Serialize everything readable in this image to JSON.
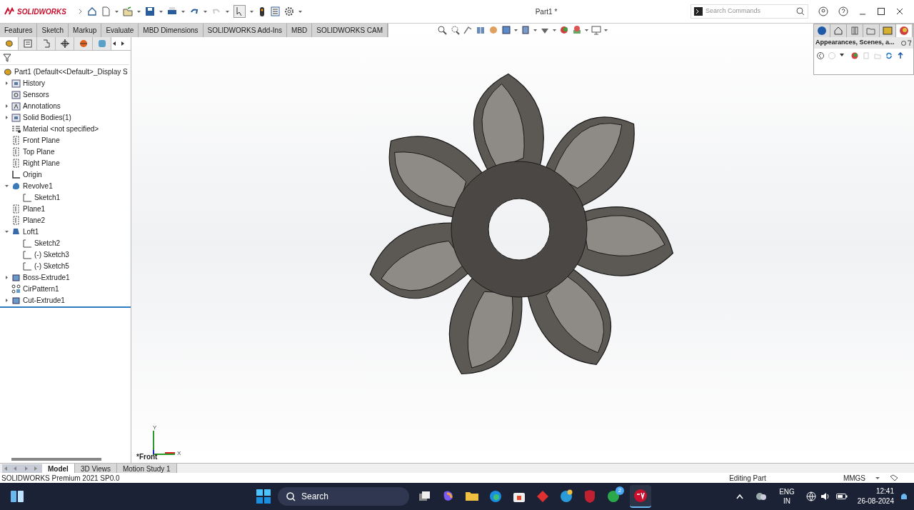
{
  "app": {
    "logo": "SOLIDWORKS",
    "title": "Part1 *",
    "search": {
      "placeholder": "Search Commands"
    }
  },
  "command_tabs": [
    {
      "label": "Features",
      "selected": false
    },
    {
      "label": "Sketch",
      "selected": false
    },
    {
      "label": "Markup",
      "selected": false
    },
    {
      "label": "Evaluate",
      "selected": false
    },
    {
      "label": "MBD Dimensions",
      "selected": false
    },
    {
      "label": "SOLIDWORKS Add-Ins",
      "selected": false
    },
    {
      "label": "MBD",
      "selected": false
    },
    {
      "label": "SOLIDWORKS CAM",
      "selected": false
    }
  ],
  "feature_tree": {
    "root": "Part1  (Default<<Default>_Display S",
    "items": [
      {
        "label": "History",
        "kind": "folder",
        "expanded": false
      },
      {
        "label": "Sensors",
        "kind": "sensor"
      },
      {
        "label": "Annotations",
        "kind": "annotation",
        "expanded": false
      },
      {
        "label": "Solid Bodies(1)",
        "kind": "folder",
        "expanded": false
      },
      {
        "label": "Material <not specified>",
        "kind": "material"
      },
      {
        "label": "Front Plane",
        "kind": "plane"
      },
      {
        "label": "Top Plane",
        "kind": "plane"
      },
      {
        "label": "Right Plane",
        "kind": "plane"
      },
      {
        "label": "Origin",
        "kind": "origin"
      },
      {
        "label": "Revolve1",
        "kind": "revolve",
        "expanded": true,
        "children": [
          {
            "label": "Sketch1",
            "kind": "sketch"
          }
        ]
      },
      {
        "label": "Plane1",
        "kind": "plane"
      },
      {
        "label": "Plane2",
        "kind": "plane"
      },
      {
        "label": "Loft1",
        "kind": "loft",
        "expanded": true,
        "children": [
          {
            "label": "Sketch2",
            "kind": "sketch"
          },
          {
            "label": "(-) Sketch3",
            "kind": "sketch"
          },
          {
            "label": "(-) Sketch5",
            "kind": "sketch"
          }
        ]
      },
      {
        "label": "Boss-Extrude1",
        "kind": "extrude",
        "expanded": false
      },
      {
        "label": "CirPattern1",
        "kind": "pattern"
      },
      {
        "label": "Cut-Extrude1",
        "kind": "extrude",
        "expanded": false
      }
    ]
  },
  "viewport": {
    "view_name": "*Front",
    "axis_labels": [
      "Y",
      "X"
    ]
  },
  "task_pane": {
    "title": "Appearances, Scenes, a..."
  },
  "bottom_tabs": [
    {
      "label": "Model",
      "selected": true
    },
    {
      "label": "3D Views",
      "selected": false
    },
    {
      "label": "Motion Study 1",
      "selected": false
    }
  ],
  "status_bar": {
    "product": "SOLIDWORKS Premium 2021 SP0.0",
    "mode": "Editing Part",
    "units": "MMGS"
  },
  "taskbar": {
    "search": "Search",
    "whatsapp_badge": "2",
    "language": "ENG",
    "region": "IN",
    "time": "12:41",
    "date": "26-08-2024"
  }
}
